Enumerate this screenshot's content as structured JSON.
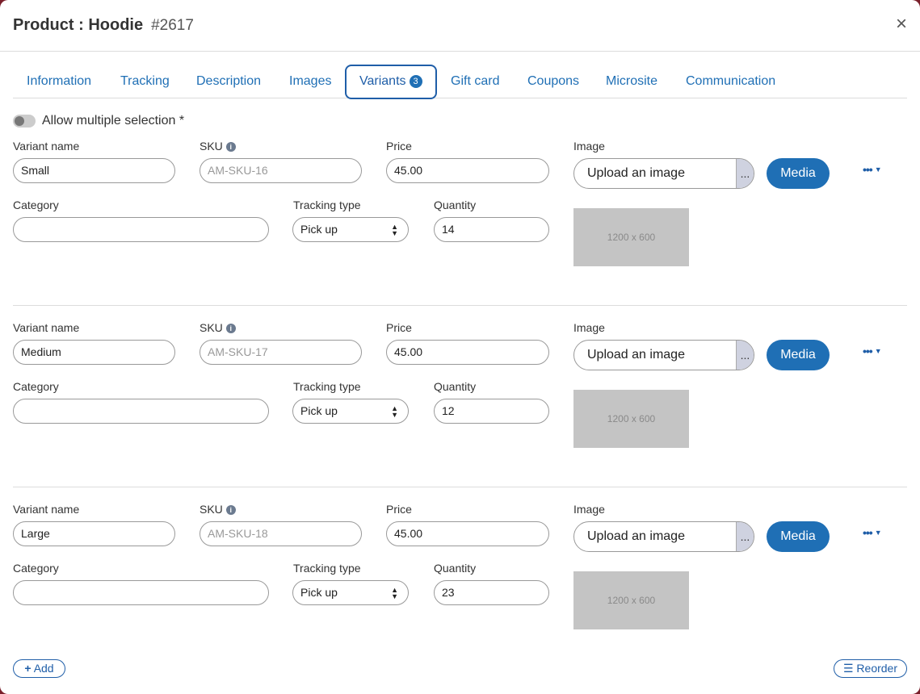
{
  "header": {
    "title": "Product : Hoodie",
    "number": "#2617",
    "close_glyph": "×"
  },
  "tabs": [
    {
      "label": "Information"
    },
    {
      "label": "Tracking"
    },
    {
      "label": "Description"
    },
    {
      "label": "Images"
    },
    {
      "label": "Variants",
      "badge": "3"
    },
    {
      "label": "Gift card"
    },
    {
      "label": "Coupons"
    },
    {
      "label": "Microsite"
    },
    {
      "label": "Communication"
    }
  ],
  "allow_multiple": {
    "label": "Allow multiple selection *",
    "enabled": false
  },
  "field_labels": {
    "variant_name": "Variant name",
    "sku": "SKU",
    "price": "Price",
    "image": "Image",
    "category": "Category",
    "tracking_type": "Tracking type",
    "quantity": "Quantity"
  },
  "upload_label": "Upload an image",
  "upload_dots": "...",
  "media_label": "Media",
  "more_glyph": "•••",
  "caret_glyph": "▼",
  "image_placeholder": "1200 x 600",
  "variants": [
    {
      "name": "Small",
      "sku_placeholder": "AM-SKU-16",
      "price": "45.00",
      "category": "",
      "tracking_type": "Pick up",
      "quantity": "14"
    },
    {
      "name": "Medium",
      "sku_placeholder": "AM-SKU-17",
      "price": "45.00",
      "category": "",
      "tracking_type": "Pick up",
      "quantity": "12"
    },
    {
      "name": "Large",
      "sku_placeholder": "AM-SKU-18",
      "price": "45.00",
      "category": "",
      "tracking_type": "Pick up",
      "quantity": "23"
    }
  ],
  "footer": {
    "add_label": "Add",
    "reorder_label": "Reorder"
  }
}
